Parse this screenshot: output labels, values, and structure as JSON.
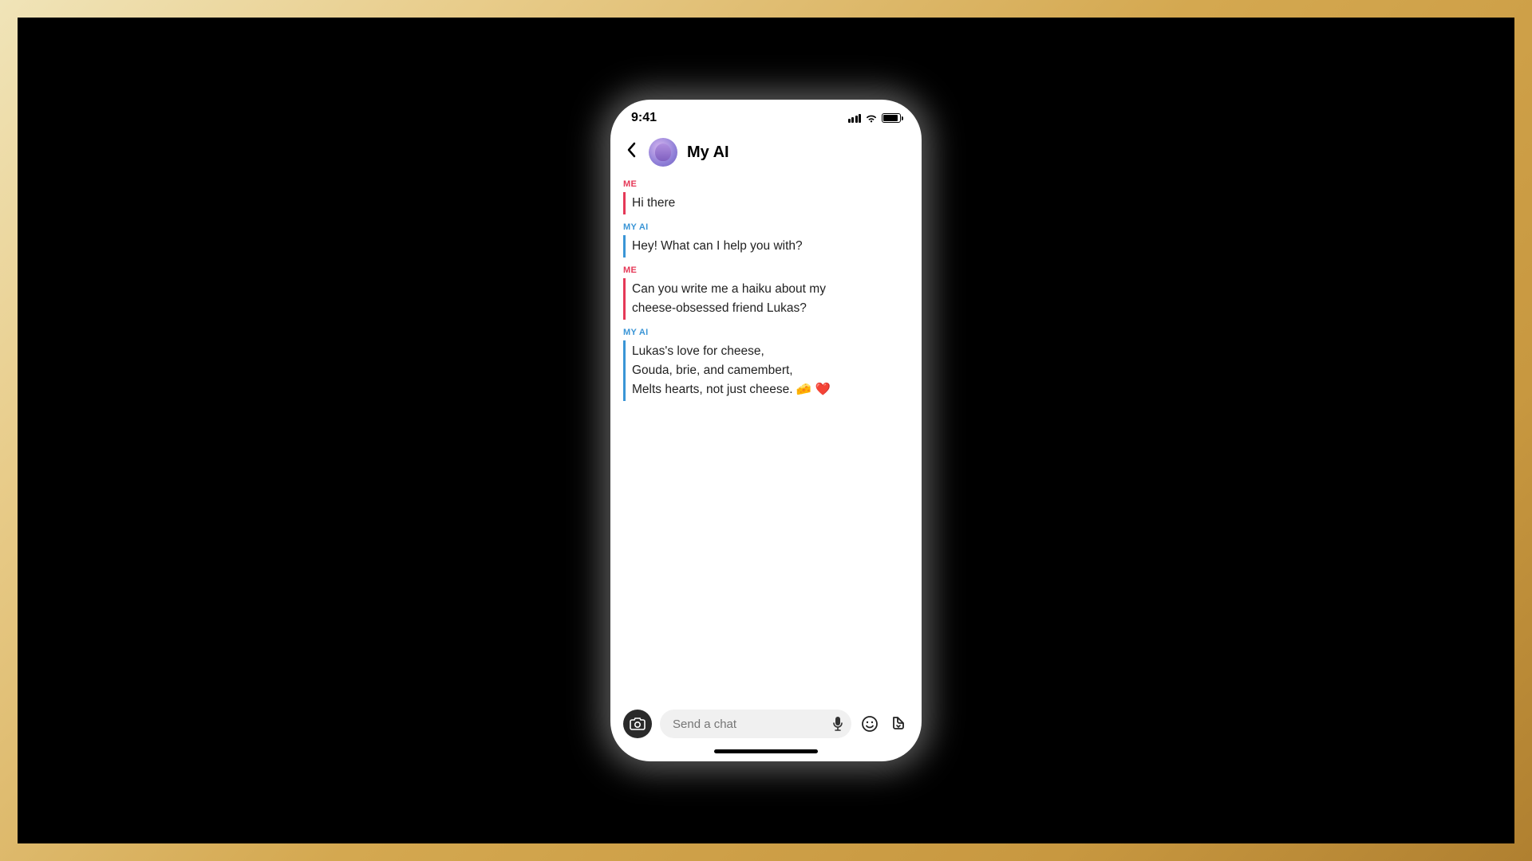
{
  "status": {
    "time": "9:41"
  },
  "header": {
    "title": "My AI"
  },
  "labels": {
    "me": "ME",
    "ai": "MY AI"
  },
  "messages": {
    "m1": "Hi there",
    "m2": "Hey! What can I help you with?",
    "m3": "Can you write me a haiku about my cheese-obsessed friend Lukas?",
    "m4": "Lukas's love for cheese,\nGouda, brie, and camembert,\nMelts hearts, not just cheese. 🧀 ❤️"
  },
  "input": {
    "placeholder": "Send a chat"
  }
}
